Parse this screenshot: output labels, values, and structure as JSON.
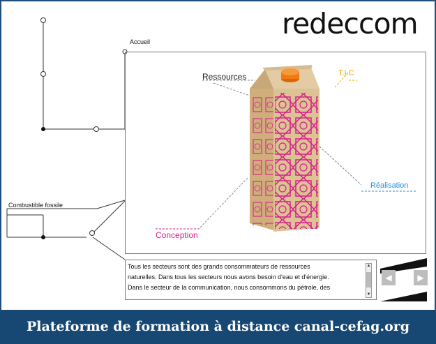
{
  "header": {
    "logo_text": "redeccom"
  },
  "nav": {
    "accueil_label": "Accueil",
    "combustible_label": "Combustible fossile"
  },
  "scene": {
    "ressources": "Ressources",
    "tic": "T.I.C",
    "realisation": "Réalisation",
    "conception": "Conception"
  },
  "text_panel": {
    "lines": [
      "Tous les secteurs sont des grands consommateurs de ressources",
      "naturelles. Dans tous les secteurs nous avons besoin d'eau et d'énergie.",
      "Dans le secteur de la communication, nous consommons du pétrole, des"
    ]
  },
  "controls": {
    "prev_icon": "prev-arrow-icon",
    "next_icon": "next-arrow-icon"
  },
  "footer": {
    "text": "Plateforme de formation à distance canal-cefag.org"
  },
  "colors": {
    "footer_bg": "#174874",
    "tic": "#f0a000",
    "realisation": "#1e90d6",
    "conception": "#d6208a",
    "carton": "#d9be93",
    "cap": "#f07a10",
    "pattern": "#d6208a"
  }
}
